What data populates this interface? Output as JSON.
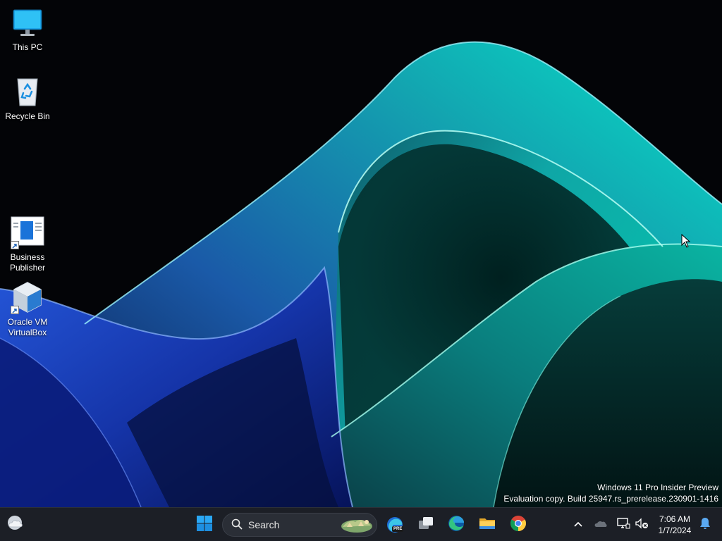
{
  "desktop": {
    "icons": [
      {
        "label": "This PC"
      },
      {
        "label": "Recycle Bin"
      },
      {
        "label": "Business Publisher"
      },
      {
        "label": "Oracle VM VirtualBox"
      }
    ],
    "watermark": {
      "line1": "Windows 11 Pro Insider Preview",
      "line2": "Evaluation copy. Build 25947.rs_prerelease.230901-1416"
    }
  },
  "taskbar": {
    "widgets_icon": "weather-cloud-icon",
    "search": {
      "label": "Search"
    },
    "pinned": [
      {
        "name": "start-button",
        "icon": "windows-logo-icon"
      },
      {
        "name": "edge-beta-button",
        "icon": "edge-beta-icon",
        "badge": "PRE"
      },
      {
        "name": "task-view-button",
        "icon": "task-view-icon"
      },
      {
        "name": "edge-button",
        "icon": "edge-icon"
      },
      {
        "name": "file-explorer-button",
        "icon": "folder-icon"
      },
      {
        "name": "chrome-button",
        "icon": "chrome-icon"
      }
    ],
    "tray": {
      "time": "7:06 AM",
      "date": "1/7/2024"
    }
  },
  "colors": {
    "taskbar_bg": "#1c1f26",
    "accent_teal": "#00d8c0",
    "accent_blue": "#1f4fe0"
  }
}
